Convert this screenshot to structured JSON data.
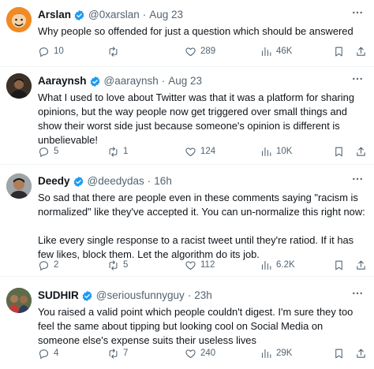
{
  "tweets": [
    {
      "name": "Arslan",
      "handle": "@0xarslan",
      "separator": "·",
      "time": "Aug 23",
      "text": [
        "Why people so offended for just a question which should be answered"
      ],
      "replies": "10",
      "retweets": "",
      "likes": "289",
      "views": "46K",
      "avatar_color": "#f08a24"
    },
    {
      "name": "Aaraynsh",
      "handle": "@aaraynsh",
      "separator": "·",
      "time": "Aug 23",
      "text": [
        "What I used to love about Twitter was that it was a platform for sharing opinions, but the way people now get triggered over small things and show their worst side just because someone's opinion is different is unbelievable!"
      ],
      "replies": "5",
      "retweets": "1",
      "likes": "124",
      "views": "10K",
      "avatar_color": "#3b3128"
    },
    {
      "name": "Deedy",
      "handle": "@deedydas",
      "separator": "·",
      "time": "16h",
      "text": [
        "So sad that there are people even in these comments saying \"racism is normalized\" like they've accepted it. You can un-normalize this right now:",
        "Like every single response to a racist tweet until they're ratiod. If it has few likes, block them. Let the algorithm do its job."
      ],
      "replies": "2",
      "retweets": "5",
      "likes": "112",
      "views": "6.2K",
      "avatar_color": "#8a6a55"
    },
    {
      "name": "SUDHIR",
      "handle": "@seriousfunnyguy",
      "separator": "·",
      "time": "23h",
      "text": [
        "You raised a valid point which people couldn't digest. I'm sure they too feel the same about tipping but looking cool on Social Media on someone else's expense suits their useless lives"
      ],
      "replies": "4",
      "retweets": "7",
      "likes": "240",
      "views": "29K",
      "avatar_color": "#4a5a3a"
    }
  ],
  "icons": {
    "verified": "verified-badge-icon",
    "more": "more-options-icon",
    "reply": "reply-icon",
    "retweet": "retweet-icon",
    "like": "heart-icon",
    "views": "views-chart-icon",
    "bookmark": "bookmark-icon",
    "share": "share-icon"
  },
  "colors": {
    "verified_blue": "#1d9bf0",
    "text_primary": "#0f1419",
    "text_secondary": "#536471",
    "divider": "#eff3f4"
  }
}
